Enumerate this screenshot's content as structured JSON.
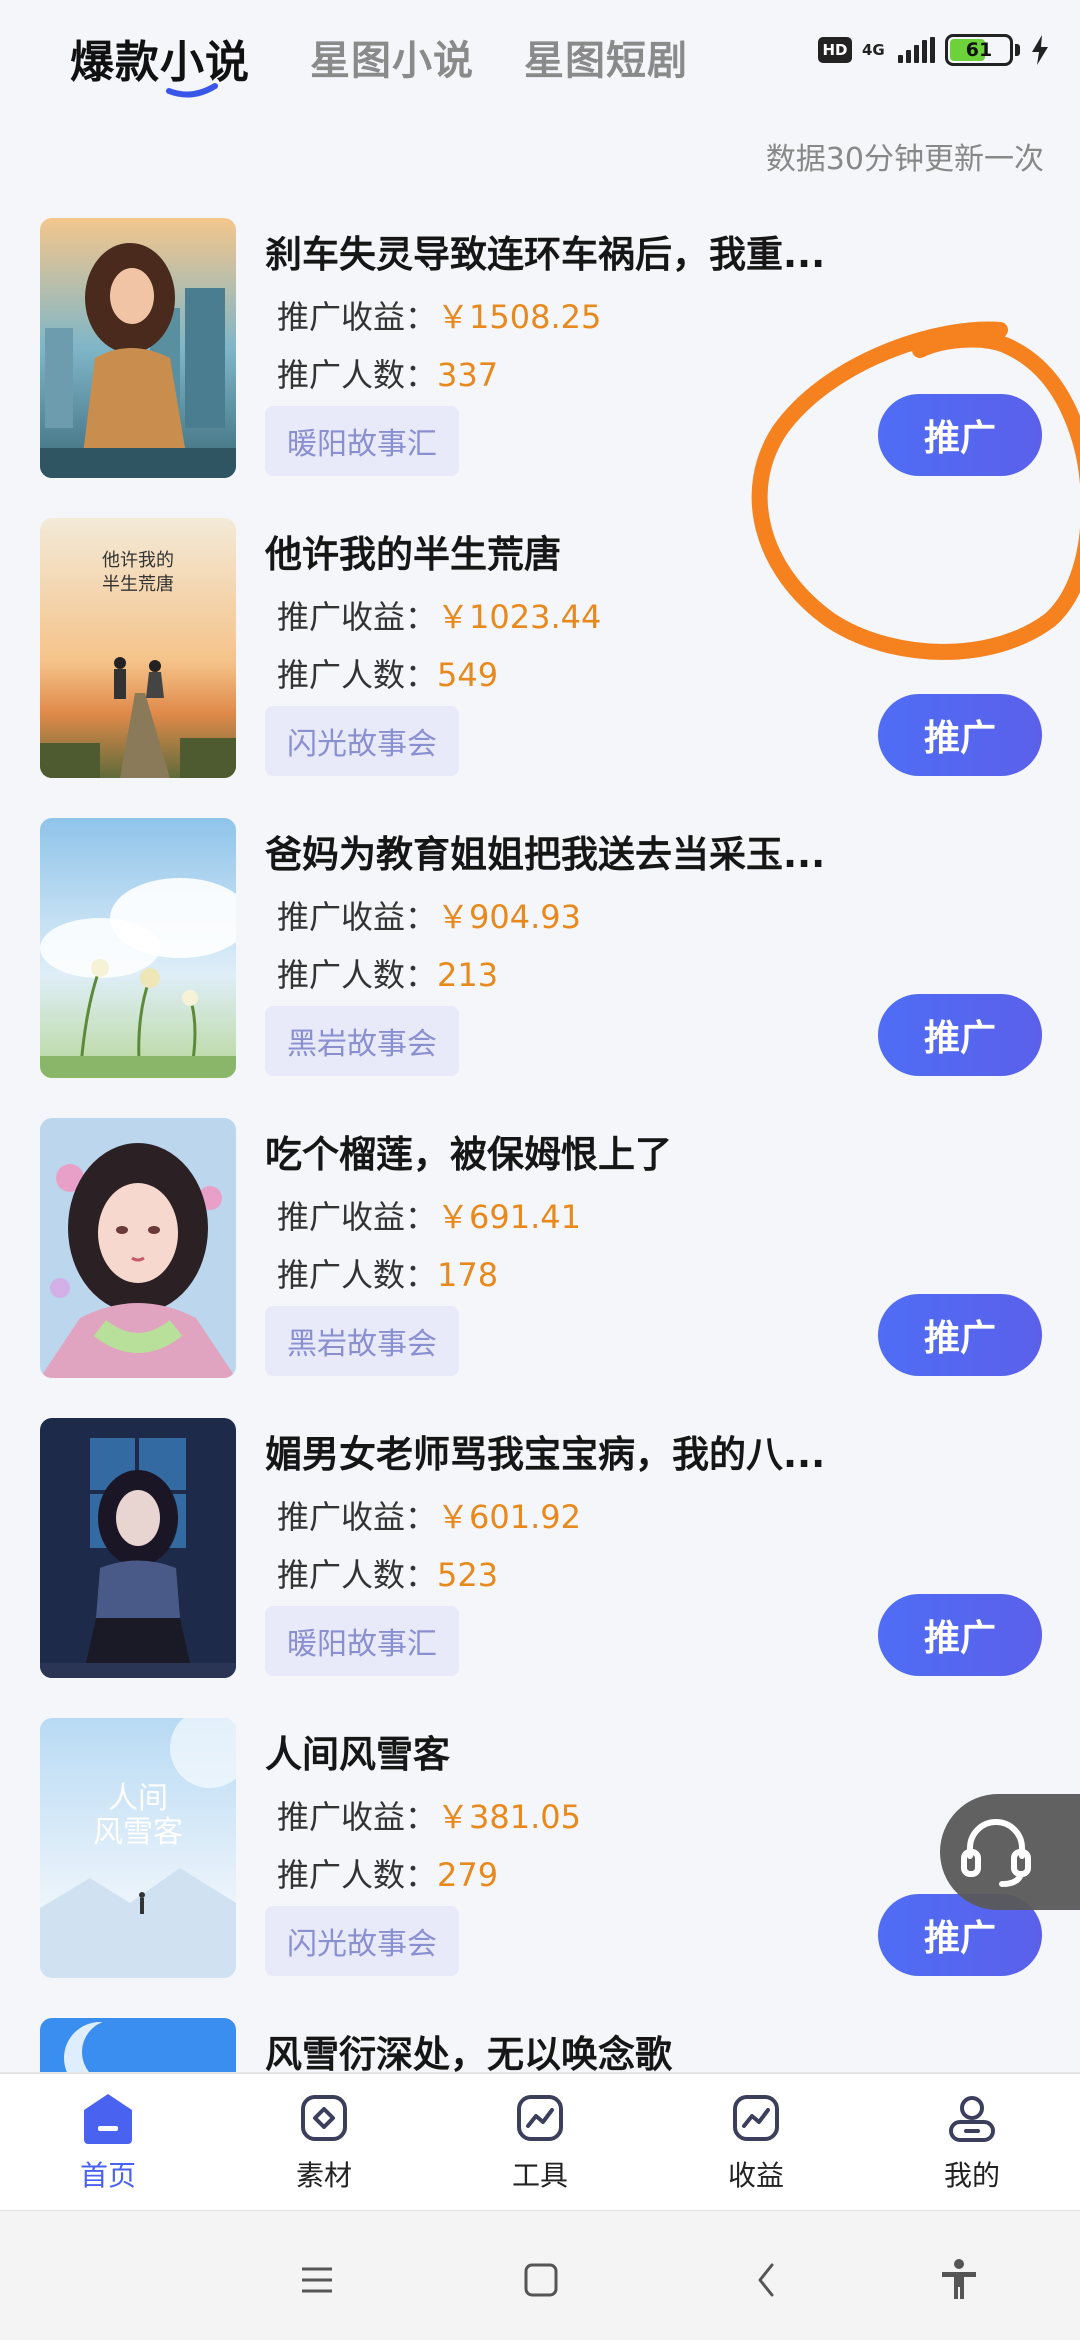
{
  "status_bar": {
    "hd": "HD",
    "network": "4G",
    "battery": "61",
    "battery_level": 0.61
  },
  "header": {
    "tabs": [
      {
        "label": "爆款小说",
        "active": true
      },
      {
        "label": "星图小说",
        "active": false
      },
      {
        "label": "星图短剧",
        "active": false
      }
    ],
    "update_note": "数据30分钟更新一次"
  },
  "labels": {
    "income": "推广收益：",
    "users": "推广人数：",
    "promote": "推广"
  },
  "items": [
    {
      "title": "刹车失灵导致连环车祸后，我重...",
      "income": "￥1508.25",
      "users": "337",
      "tag": "暖阳故事汇"
    },
    {
      "title": "他许我的半生荒唐",
      "income": "￥1023.44",
      "users": "549",
      "tag": "闪光故事会",
      "cover_text": "他许我的半生荒唐"
    },
    {
      "title": "爸妈为教育姐姐把我送去当采玉...",
      "income": "￥904.93",
      "users": "213",
      "tag": "黑岩故事会"
    },
    {
      "title": "吃个榴莲，被保姆恨上了",
      "income": "￥691.41",
      "users": "178",
      "tag": "黑岩故事会"
    },
    {
      "title": "媚男女老师骂我宝宝病，我的八...",
      "income": "￥601.92",
      "users": "523",
      "tag": "暖阳故事汇"
    },
    {
      "title": "人间风雪客",
      "income": "￥381.05",
      "users": "279",
      "tag": "闪光故事会",
      "cover_text": "人间风雪客"
    },
    {
      "title": "风雪衍深处，无以唤念歌"
    }
  ],
  "bottom_nav": [
    {
      "label": "首页",
      "icon": "home-icon",
      "active": true
    },
    {
      "label": "素材",
      "icon": "material-icon",
      "active": false
    },
    {
      "label": "工具",
      "icon": "tools-icon",
      "active": false
    },
    {
      "label": "收益",
      "icon": "earnings-icon",
      "active": false
    },
    {
      "label": "我的",
      "icon": "profile-icon",
      "active": false
    }
  ],
  "colors": {
    "accent": "#4f6df5",
    "money": "#e8891d",
    "annotation": "#f5821f"
  }
}
